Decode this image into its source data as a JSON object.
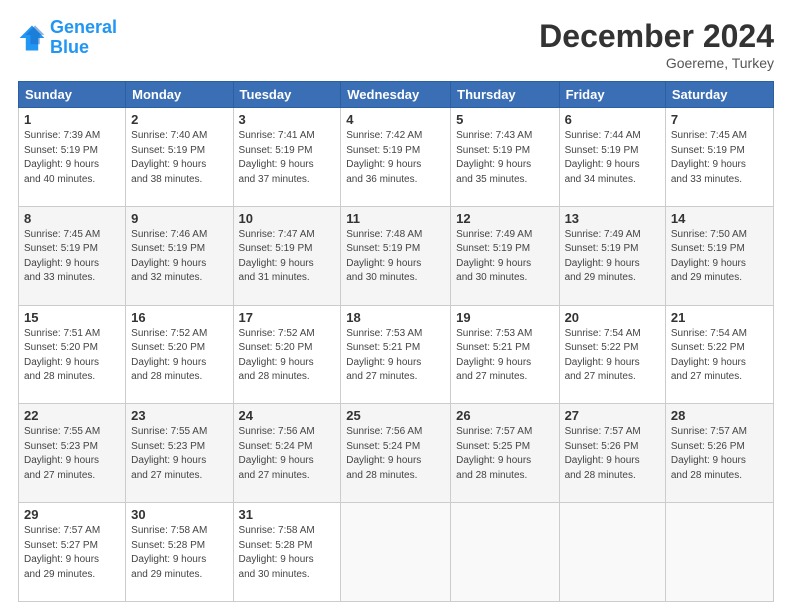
{
  "logo": {
    "line1": "General",
    "line2": "Blue"
  },
  "title": "December 2024",
  "location": "Goereme, Turkey",
  "days_header": [
    "Sunday",
    "Monday",
    "Tuesday",
    "Wednesday",
    "Thursday",
    "Friday",
    "Saturday"
  ],
  "weeks": [
    [
      {
        "day": "1",
        "info": "Sunrise: 7:39 AM\nSunset: 5:19 PM\nDaylight: 9 hours\nand 40 minutes."
      },
      {
        "day": "2",
        "info": "Sunrise: 7:40 AM\nSunset: 5:19 PM\nDaylight: 9 hours\nand 38 minutes."
      },
      {
        "day": "3",
        "info": "Sunrise: 7:41 AM\nSunset: 5:19 PM\nDaylight: 9 hours\nand 37 minutes."
      },
      {
        "day": "4",
        "info": "Sunrise: 7:42 AM\nSunset: 5:19 PM\nDaylight: 9 hours\nand 36 minutes."
      },
      {
        "day": "5",
        "info": "Sunrise: 7:43 AM\nSunset: 5:19 PM\nDaylight: 9 hours\nand 35 minutes."
      },
      {
        "day": "6",
        "info": "Sunrise: 7:44 AM\nSunset: 5:19 PM\nDaylight: 9 hours\nand 34 minutes."
      },
      {
        "day": "7",
        "info": "Sunrise: 7:45 AM\nSunset: 5:19 PM\nDaylight: 9 hours\nand 33 minutes."
      }
    ],
    [
      {
        "day": "8",
        "info": "Sunrise: 7:45 AM\nSunset: 5:19 PM\nDaylight: 9 hours\nand 33 minutes."
      },
      {
        "day": "9",
        "info": "Sunrise: 7:46 AM\nSunset: 5:19 PM\nDaylight: 9 hours\nand 32 minutes."
      },
      {
        "day": "10",
        "info": "Sunrise: 7:47 AM\nSunset: 5:19 PM\nDaylight: 9 hours\nand 31 minutes."
      },
      {
        "day": "11",
        "info": "Sunrise: 7:48 AM\nSunset: 5:19 PM\nDaylight: 9 hours\nand 30 minutes."
      },
      {
        "day": "12",
        "info": "Sunrise: 7:49 AM\nSunset: 5:19 PM\nDaylight: 9 hours\nand 30 minutes."
      },
      {
        "day": "13",
        "info": "Sunrise: 7:49 AM\nSunset: 5:19 PM\nDaylight: 9 hours\nand 29 minutes."
      },
      {
        "day": "14",
        "info": "Sunrise: 7:50 AM\nSunset: 5:19 PM\nDaylight: 9 hours\nand 29 minutes."
      }
    ],
    [
      {
        "day": "15",
        "info": "Sunrise: 7:51 AM\nSunset: 5:20 PM\nDaylight: 9 hours\nand 28 minutes."
      },
      {
        "day": "16",
        "info": "Sunrise: 7:52 AM\nSunset: 5:20 PM\nDaylight: 9 hours\nand 28 minutes."
      },
      {
        "day": "17",
        "info": "Sunrise: 7:52 AM\nSunset: 5:20 PM\nDaylight: 9 hours\nand 28 minutes."
      },
      {
        "day": "18",
        "info": "Sunrise: 7:53 AM\nSunset: 5:21 PM\nDaylight: 9 hours\nand 27 minutes."
      },
      {
        "day": "19",
        "info": "Sunrise: 7:53 AM\nSunset: 5:21 PM\nDaylight: 9 hours\nand 27 minutes."
      },
      {
        "day": "20",
        "info": "Sunrise: 7:54 AM\nSunset: 5:22 PM\nDaylight: 9 hours\nand 27 minutes."
      },
      {
        "day": "21",
        "info": "Sunrise: 7:54 AM\nSunset: 5:22 PM\nDaylight: 9 hours\nand 27 minutes."
      }
    ],
    [
      {
        "day": "22",
        "info": "Sunrise: 7:55 AM\nSunset: 5:23 PM\nDaylight: 9 hours\nand 27 minutes."
      },
      {
        "day": "23",
        "info": "Sunrise: 7:55 AM\nSunset: 5:23 PM\nDaylight: 9 hours\nand 27 minutes."
      },
      {
        "day": "24",
        "info": "Sunrise: 7:56 AM\nSunset: 5:24 PM\nDaylight: 9 hours\nand 27 minutes."
      },
      {
        "day": "25",
        "info": "Sunrise: 7:56 AM\nSunset: 5:24 PM\nDaylight: 9 hours\nand 28 minutes."
      },
      {
        "day": "26",
        "info": "Sunrise: 7:57 AM\nSunset: 5:25 PM\nDaylight: 9 hours\nand 28 minutes."
      },
      {
        "day": "27",
        "info": "Sunrise: 7:57 AM\nSunset: 5:26 PM\nDaylight: 9 hours\nand 28 minutes."
      },
      {
        "day": "28",
        "info": "Sunrise: 7:57 AM\nSunset: 5:26 PM\nDaylight: 9 hours\nand 28 minutes."
      }
    ],
    [
      {
        "day": "29",
        "info": "Sunrise: 7:57 AM\nSunset: 5:27 PM\nDaylight: 9 hours\nand 29 minutes."
      },
      {
        "day": "30",
        "info": "Sunrise: 7:58 AM\nSunset: 5:28 PM\nDaylight: 9 hours\nand 29 minutes."
      },
      {
        "day": "31",
        "info": "Sunrise: 7:58 AM\nSunset: 5:28 PM\nDaylight: 9 hours\nand 30 minutes."
      },
      {
        "day": "",
        "info": ""
      },
      {
        "day": "",
        "info": ""
      },
      {
        "day": "",
        "info": ""
      },
      {
        "day": "",
        "info": ""
      }
    ]
  ]
}
